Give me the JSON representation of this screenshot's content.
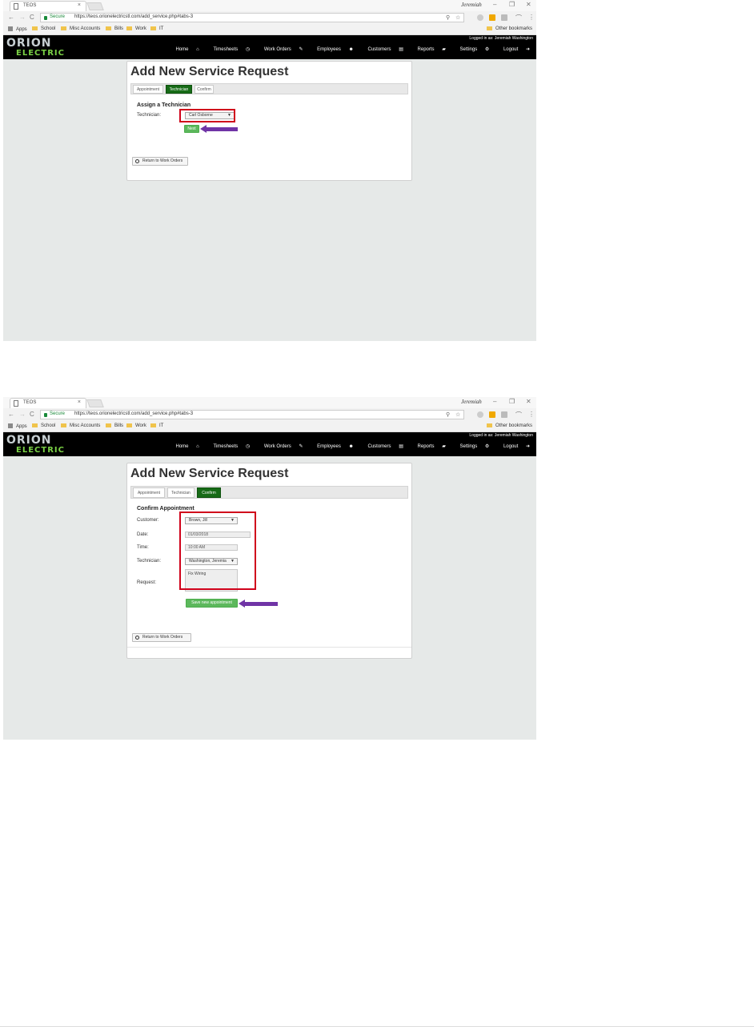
{
  "browser": {
    "tab_title": "TEOS",
    "tab_close": "×",
    "user_name": "Jeremiah",
    "secure_label": "Secure",
    "url_1": "https://teos.orionelectricstl.com/add_service.php#tabs-3",
    "url_2": "https://teos.orionelectricstl.com/add_service.php#tabs-3",
    "bookmarks": [
      "Apps",
      "School",
      "Misc Accounts",
      "Bills",
      "Work",
      "IT"
    ],
    "other_bookmarks": "Other bookmarks"
  },
  "site": {
    "logo_top": "ORION",
    "logo_bottom": "ELECTRIC",
    "logged_in": "Logged in as: Jeremiah Washington",
    "nav": [
      "Home",
      "Timesheets",
      "Work Orders",
      "Employees",
      "Customers",
      "Reports",
      "Settings",
      "Logout"
    ],
    "nav_icons": [
      "home-icon",
      "clock-icon",
      "edit-icon",
      "users-icon",
      "table-icon",
      "book-icon",
      "gears-icon",
      "logout-icon"
    ]
  },
  "page": {
    "title": "Add New Service Request",
    "tabs": [
      "Appointment",
      "Technician",
      "Confirm"
    ],
    "return_button": "Return to Work Orders"
  },
  "step1": {
    "active_tab": "Technician",
    "section_heading": "Assign a Technician",
    "technician_label": "Technician:",
    "technician_value": "Carl Osborne",
    "next_button": "Next"
  },
  "step2": {
    "active_tab": "Confirm",
    "section_heading": "Confirm Appointment",
    "customer_label": "Customer:",
    "customer_value": "Brown, Jill",
    "date_label": "Date:",
    "date_value": "01/03/2018",
    "time_label": "Time:",
    "time_value": "10:00 AM",
    "technician_label": "Technician:",
    "technician_value": "Washington, Jeremia",
    "request_label": "Request:",
    "request_value": "Fix Wiring",
    "save_button": "Save new appointment"
  },
  "colors": {
    "accent_green": "#176b17",
    "button_green": "#5cb85c",
    "highlight_red": "#d0021b",
    "arrow_purple": "#7034a6",
    "logo_green": "#7ad145"
  }
}
